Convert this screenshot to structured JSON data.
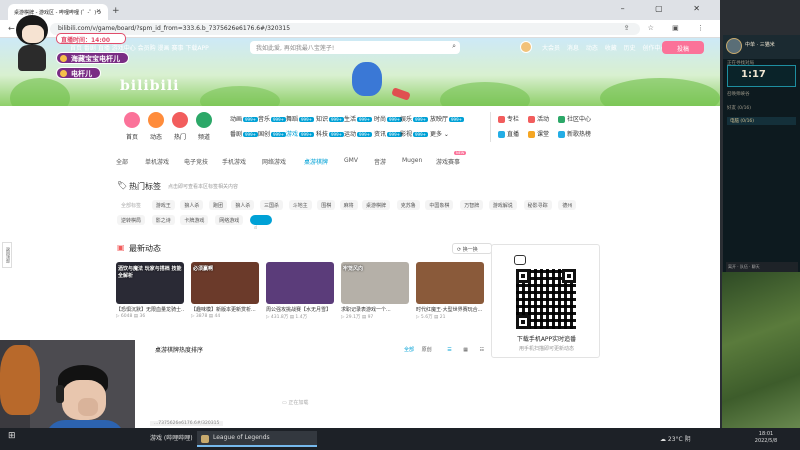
{
  "browser": {
    "tab_title": "桌游棋牌 - 游戏区 - 哔哩哔哩 (゜-゜)つ",
    "url": "bilibili.com/v/game/board/?spm_id_from=333.6.b_7375626e6176.6#/320315"
  },
  "topnav": {
    "left_items": "首页  番剧  直播  游戏中心  会员购  漫画  赛事  下载APP",
    "search_placeholder": "我如此爱, 再如我最八宝莲子!",
    "right_items": "大会员  消息  动态  收藏  历史  创作中心",
    "upload_label": "投稿",
    "logo": "bilibili"
  },
  "channels": {
    "main": [
      {
        "label": "首页",
        "color": "#fb7299"
      },
      {
        "label": "动态",
        "color": "#ff8c3b"
      },
      {
        "label": "热门",
        "color": "#f25d5d"
      },
      {
        "label": "频道",
        "color": "#2ca868"
      }
    ],
    "grid": [
      {
        "label": "动画",
        "count": "999+"
      },
      {
        "label": "音乐",
        "count": "999+"
      },
      {
        "label": "舞蹈",
        "count": "999+"
      },
      {
        "label": "知识",
        "count": "999+"
      },
      {
        "label": "生活",
        "count": "999+"
      },
      {
        "label": "时尚",
        "count": "999+"
      },
      {
        "label": "娱乐",
        "count": "999+"
      },
      {
        "label": "放映厅",
        "count": "999+"
      },
      {
        "label": "番剧",
        "count": "999+"
      },
      {
        "label": "国创",
        "count": "999+"
      },
      {
        "label": "游戏",
        "count": "999+"
      },
      {
        "label": "科技",
        "count": "999+"
      },
      {
        "label": "运动",
        "count": "999+"
      },
      {
        "label": "资讯",
        "count": "999+"
      },
      {
        "label": "影视",
        "count": "999+"
      },
      {
        "label": "更多",
        "count": ""
      }
    ],
    "side": [
      {
        "label": "专栏",
        "color": "#f25d5d"
      },
      {
        "label": "活动",
        "color": "#f25d5d"
      },
      {
        "label": "社区中心",
        "color": "#2ca868"
      },
      {
        "label": "直播",
        "color": "#23ade5"
      },
      {
        "label": "课堂",
        "color": "#f5a623"
      },
      {
        "label": "新歌热榜",
        "color": "#23ade5"
      }
    ]
  },
  "subnav": {
    "items": [
      "全部",
      "单机游戏",
      "电子竞技",
      "手机游戏",
      "网络游戏",
      "桌游棋牌",
      "GMV",
      "音游",
      "Mugen",
      "游戏赛事"
    ],
    "hot_badge": "NEW"
  },
  "hot_tags": {
    "title": "热门标签",
    "subtitle": "点击即可查看本区标签相关内容",
    "row1": [
      "全部标签",
      "游戏王",
      "狼人杀",
      "跑团",
      "狼人杀",
      "三国杀",
      "斗地主",
      "围棋",
      "麻将",
      "桌游棋牌",
      "克苏鲁",
      "中国象棋",
      "万智牌",
      "游戏解说",
      "秘影寻踪",
      "德州"
    ],
    "row2": [
      "逆转棋局",
      "影之诗",
      "卡牌游戏",
      "网络游戏",
      ""
    ]
  },
  "dynamics": {
    "title": "最新动态",
    "refresh_label": "换一换",
    "cards": [
      {
        "overlay": "酒饮与魔法 玩家与搭档 技能全解析",
        "title": "【恐惧沉默】无限血量龙骑士...",
        "views": "6048",
        "comments": "36",
        "bg": "#2a2a35"
      },
      {
        "overlay": "必须赢啊",
        "title": "【趣味模】新版本更新赏析...",
        "views": "3878",
        "comments": "44",
        "bg": "#6b3a2a"
      },
      {
        "overlay": "",
        "title": "周公强攻挑战赛【水无月雪】",
        "views": "431.8万",
        "comments": "1.4万",
        "bg": "#5b3c7a"
      },
      {
        "overlay": "牢笼风向",
        "title": "求职记录表游戏一个...",
        "views": "29.1万",
        "comments": "97",
        "bg": "#b5b0a8"
      },
      {
        "overlay": "",
        "title": "时代红魔王·大型世界赛玩合...",
        "views": "5.6万",
        "comments": "21",
        "bg": "#8a5a3a"
      }
    ]
  },
  "qr": {
    "title": "下载手机APP实时追番",
    "subtitle": "用手机扫描即可更新动态"
  },
  "ranking": {
    "title": "桌游棋牌热度排序",
    "tabs": [
      "全部",
      "原创"
    ],
    "empty_text": "正在加载",
    "status_url": "...7375626e6176.6#/320315"
  },
  "side_float": "返回顶部",
  "overlay": {
    "live_time": "直播时间：14:00",
    "pill1": "海藏宝宝电杆儿",
    "pill2": "电杆儿"
  },
  "game_client": {
    "player_name": "中单 · 三猫米",
    "queue_label": "正在寻找对局",
    "timer": "1:17",
    "mode": "召唤师峡谷",
    "party_label": "好友 (0/16)",
    "row_label": "电脑 (0/16)",
    "bottom": "离开 · 队伍 · 聊天"
  },
  "taskbar": {
    "items": [
      "游戏 (哔哩哔哩)",
      "League of Legends"
    ],
    "weather": "23°C 阴",
    "time": "18:01",
    "date": "2022/5/8"
  }
}
